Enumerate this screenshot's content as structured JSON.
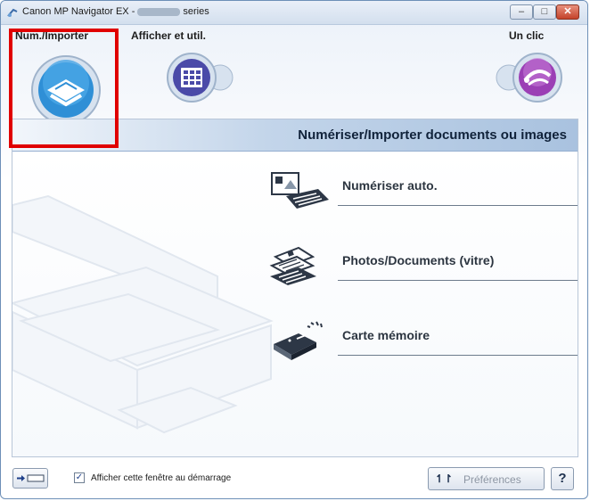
{
  "window": {
    "title_prefix": "Canon MP Navigator EX -",
    "title_suffix": "series",
    "minimize_glyph": "–",
    "maximize_glyph": "□",
    "close_glyph": "✕"
  },
  "modes": [
    {
      "label": "Num./Importer",
      "icon": "scanner-icon",
      "selected": true
    },
    {
      "label": "Afficher et util.",
      "icon": "grid-view-icon",
      "selected": false
    },
    {
      "label": "Un clic",
      "icon": "one-click-icon",
      "selected": false
    }
  ],
  "panel": {
    "title": "Numériser/Importer documents ou images",
    "actions": [
      {
        "label": "Numériser auto.",
        "icon": "auto-scan-icon"
      },
      {
        "label": "Photos/Documents (vitre)",
        "icon": "platen-documents-icon"
      },
      {
        "label": "Carte mémoire",
        "icon": "memory-card-icon"
      }
    ]
  },
  "footer": {
    "checkbox_checked": true,
    "check_mark": "✓",
    "checkbox_label": "Afficher cette fenêtre au démarrage",
    "preferences_icon": "↿↾",
    "preferences_label": "Préférences",
    "help_label": "?"
  },
  "colors": {
    "highlight": "#e00000",
    "scanner_blue": "#2f8fd6",
    "grid_purple": "#4a4aa8",
    "oneclick_purple": "#9b3fb5"
  }
}
